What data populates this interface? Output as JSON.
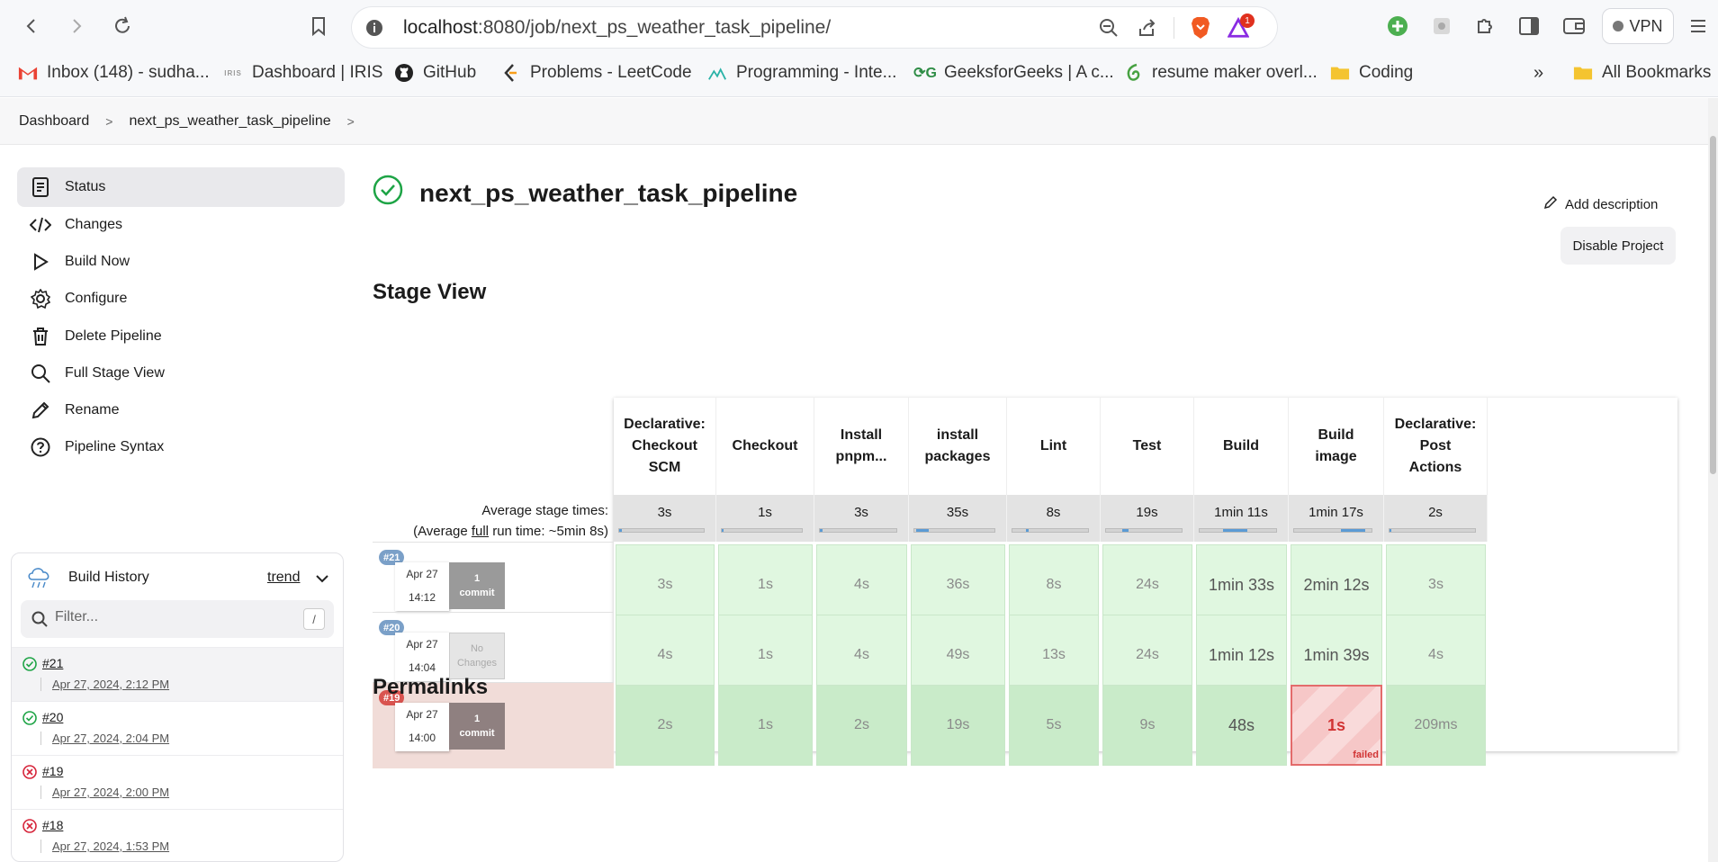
{
  "browser": {
    "url_host": "localhost",
    "url_rest": ":8080/job/next_ps_weather_task_pipeline/",
    "vpn_label": "VPN",
    "notification_count": "1",
    "bookmarks": [
      {
        "label": "Inbox (148) - sudha...",
        "icon": "gmail-icon"
      },
      {
        "label": "Dashboard | IRIS",
        "icon": "iris-icon"
      },
      {
        "label": "GitHub",
        "icon": "github-icon"
      },
      {
        "label": "Problems - LeetCode",
        "icon": "leetcode-icon"
      },
      {
        "label": "Programming - Inte...",
        "icon": "programming-icon"
      },
      {
        "label": "GeeksforGeeks | A c...",
        "icon": "gfg-icon"
      },
      {
        "label": "resume maker overl...",
        "icon": "overleaf-icon"
      },
      {
        "label": "Coding",
        "icon": "folder-icon"
      }
    ],
    "all_bookmarks": "All Bookmarks",
    "overflow": "»"
  },
  "breadcrumb": {
    "items": [
      "Dashboard",
      "next_ps_weather_task_pipeline"
    ]
  },
  "sidebar": {
    "items": [
      {
        "label": "Status",
        "icon": "status-icon"
      },
      {
        "label": "Changes",
        "icon": "code-icon"
      },
      {
        "label": "Build Now",
        "icon": "play-icon"
      },
      {
        "label": "Configure",
        "icon": "gear-icon"
      },
      {
        "label": "Delete Pipeline",
        "icon": "trash-icon"
      },
      {
        "label": "Full Stage View",
        "icon": "search-icon"
      },
      {
        "label": "Rename",
        "icon": "pencil-icon"
      },
      {
        "label": "Pipeline Syntax",
        "icon": "help-icon"
      }
    ]
  },
  "build_history": {
    "title": "Build History",
    "trend": "trend",
    "filter_placeholder": "Filter...",
    "filter_shortcut": "/",
    "builds": [
      {
        "num": "#21",
        "date": "Apr 27, 2024, 2:12 PM",
        "status": "success"
      },
      {
        "num": "#20",
        "date": "Apr 27, 2024, 2:04 PM",
        "status": "success"
      },
      {
        "num": "#19",
        "date": "Apr 27, 2024, 2:00 PM",
        "status": "failed"
      },
      {
        "num": "#18",
        "date": "Apr 27, 2024, 1:53 PM",
        "status": "failed"
      }
    ]
  },
  "main": {
    "title": "next_ps_weather_task_pipeline",
    "add_description": "Add description",
    "disable_project": "Disable Project",
    "stage_view_heading": "Stage View",
    "permalinks_heading": "Permalinks"
  },
  "stage_view": {
    "avg_label_line1": "Average stage times:",
    "avg_label_prefix": "(Average ",
    "avg_label_full": "full",
    "avg_label_suffix": " run time: ~5min 8s)",
    "stages": [
      {
        "name": "Declarative: Checkout SCM",
        "avg": "3s"
      },
      {
        "name": "Checkout",
        "avg": "1s"
      },
      {
        "name": "Install pnpm...",
        "avg": "3s"
      },
      {
        "name": "install packages",
        "avg": "35s"
      },
      {
        "name": "Lint",
        "avg": "8s"
      },
      {
        "name": "Test",
        "avg": "19s"
      },
      {
        "name": "Build",
        "avg": "1min 11s"
      },
      {
        "name": "Build image",
        "avg": "1min 17s"
      },
      {
        "name": "Declarative: Post Actions",
        "avg": "2s"
      }
    ],
    "runs": [
      {
        "id": "#21",
        "date": "Apr 27",
        "time": "14:12",
        "commit_num": "1",
        "commit_label": "commit",
        "status": "success",
        "times": [
          "3s",
          "1s",
          "4s",
          "36s",
          "8s",
          "24s",
          "1min 33s",
          "2min 12s",
          "3s"
        ]
      },
      {
        "id": "#20",
        "date": "Apr 27",
        "time": "14:04",
        "commit_num": "No",
        "commit_label": "Changes",
        "status": "success",
        "times": [
          "4s",
          "1s",
          "4s",
          "49s",
          "13s",
          "24s",
          "1min 12s",
          "1min 39s",
          "4s"
        ]
      },
      {
        "id": "#19",
        "date": "Apr 27",
        "time": "14:00",
        "commit_num": "1",
        "commit_label": "commit",
        "status": "failed",
        "times": [
          "2s",
          "1s",
          "2s",
          "19s",
          "5s",
          "9s",
          "48s",
          "1s",
          "209ms"
        ],
        "failed_tag": "failed"
      }
    ]
  }
}
